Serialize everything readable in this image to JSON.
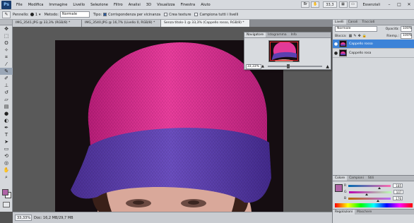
{
  "menubar": {
    "logo": "Ps",
    "items": [
      "File",
      "Modifica",
      "Immagine",
      "Livello",
      "Selezione",
      "Filtro",
      "Analisi",
      "3D",
      "Visualizza",
      "Finestra",
      "Aiuto"
    ],
    "zoom": "33,3",
    "workspace": "Essenziali"
  },
  "options": {
    "brush_label": "Pennello:",
    "brush_size": "1",
    "mode_label": "Metodo:",
    "mode_value": "Normale",
    "type_label": "Tipo:",
    "opt1": "Corrispondenza per vicinanza",
    "opt2": "Crea texture",
    "opt3": "Campiona tutti i livelli"
  },
  "tabs": [
    {
      "label": "IMG_3541.JPG @ 33,3% (RGB/8) *"
    },
    {
      "label": "IMG_3540.JPG @ 16,7% (Livello 0, RGB/8) *"
    },
    {
      "label": "Senza titolo-1 @ 33,3% (Cappello rosso, RGB/8) *"
    }
  ],
  "navigator": {
    "tabs": [
      "Navigatore",
      "Istogramma",
      "Info"
    ],
    "zoom": "33,33%"
  },
  "layers": {
    "tabs": [
      "Livelli",
      "Canali",
      "Tracciati"
    ],
    "mode": "Normale",
    "opacity_label": "Opacità:",
    "opacity": "100%",
    "lock_label": "Blocca:",
    "fill_label": "Riemp.:",
    "fill": "100%",
    "items": [
      {
        "name": "Cappello rosso"
      },
      {
        "name": "Cappello rosa"
      }
    ]
  },
  "color": {
    "tabs": [
      "Colore",
      "Campioni",
      "Stili"
    ],
    "r_label": "R",
    "g_label": "G",
    "b_label": "B",
    "r": "185",
    "g": "107",
    "b": "176",
    "r_level": 0.73,
    "g_level": 0.42,
    "b_level": 0.69,
    "fg": "#b064a6",
    "bottom_tabs": [
      "Regolazioni",
      "Maschere"
    ]
  },
  "status": {
    "zoom": "33,33%",
    "doc": "Doc: 16,2 MB/29,7 MB"
  }
}
